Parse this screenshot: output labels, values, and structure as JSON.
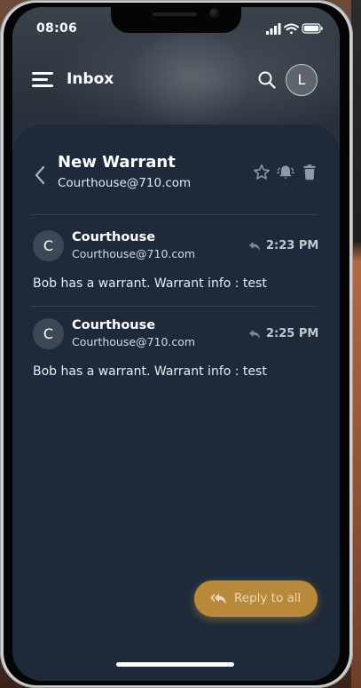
{
  "status_bar": {
    "time": "08:06"
  },
  "header": {
    "title": "Inbox",
    "avatar_initial": "L"
  },
  "thread": {
    "subject": "New Warrant",
    "from": "Courthouse@710.com",
    "actions": [
      "star-icon",
      "bell-icon",
      "trash-icon"
    ]
  },
  "messages": [
    {
      "avatar_initial": "C",
      "sender": "Courthouse",
      "address": "Courthouse@710.com",
      "time": "2:23 PM",
      "body": "Bob has a warrant. Warrant info : test"
    },
    {
      "avatar_initial": "C",
      "sender": "Courthouse",
      "address": "Courthouse@710.com",
      "time": "2:25 PM",
      "body": "Bob has a warrant. Warrant info : test"
    }
  ],
  "reply_all": {
    "label": "Reply to all"
  },
  "colors": {
    "card_bg": "#1e2a3a",
    "accent": "#b8893b",
    "divider": "#334155"
  }
}
